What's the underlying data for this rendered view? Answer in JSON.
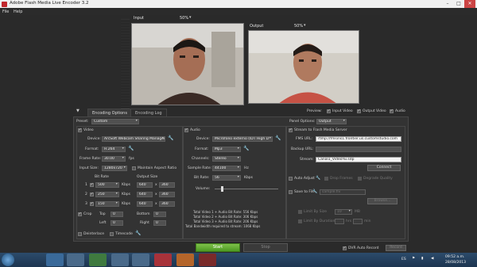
{
  "window": {
    "title": "Adobe Flash Media Live Encoder 3.2"
  },
  "menu": {
    "file": "File",
    "help": "Help"
  },
  "preview": {
    "input_label": "Input",
    "input_zoom": "50%",
    "output_label": "Output",
    "output_zoom": "50%",
    "preview_label": "Preview:",
    "input_video": "Input Video",
    "output_video": "Output Video",
    "audio": "Audio"
  },
  "tabs": {
    "encoding_options": "Encoding Options",
    "encoding_log": "Encoding Log"
  },
  "presets": {
    "label": "Preset:",
    "value": "Custom"
  },
  "panel_options": {
    "label": "Panel Options:",
    "value": "Output"
  },
  "video": {
    "section": "Video",
    "device_label": "Device:",
    "device_value": "ArcSoft Webcam Sharing Manager",
    "format_label": "Format:",
    "format_value": "H.264",
    "frame_rate_label": "Frame Rate:",
    "frame_rate_value": "30.00",
    "fps": "fps",
    "input_size_label": "Input Size:",
    "input_size_value": "1280x720",
    "maintain_aspect": "Maintain Aspect Ratio",
    "bit_rate_header": "Bit Rate",
    "output_size_header": "Output Size",
    "rows": [
      {
        "num": "1",
        "bitrate": "500",
        "unit": "Kbps",
        "w": "640",
        "h": "360"
      },
      {
        "num": "2",
        "bitrate": "250",
        "unit": "Kbps",
        "w": "640",
        "h": "360"
      },
      {
        "num": "3",
        "bitrate": "150",
        "unit": "Kbps",
        "w": "640",
        "h": "360"
      }
    ],
    "crop_label": "Crop",
    "top_label": "Top",
    "top_value": "0",
    "bottom_label": "Bottom",
    "bottom_value": "0",
    "left_label": "Left",
    "left_value": "0",
    "right_label": "Right",
    "right_value": "0",
    "deinterlace": "Deinterlace",
    "timecode": "Timecode"
  },
  "audio": {
    "section": "Audio",
    "device_label": "Device:",
    "device_value": "Micrófono externo (IDT High D",
    "format_label": "Format:",
    "format_value": "Mp3",
    "channels_label": "Channels:",
    "channels_value": "Stereo",
    "sample_rate_label": "Sample Rate:",
    "sample_rate_value": "44100",
    "hz": "Hz",
    "bit_rate_label": "Bit Rate:",
    "bit_rate_value": "56",
    "kbps": "Kbps",
    "volume_label": "Volume:",
    "volume_level": 0.1
  },
  "totals": [
    "Total Video 1 + Audio Bit Rate: 556 Kbps",
    "Total Video 2 + Audio Bit Rate: 306 Kbps",
    "Total Video 3 + Audio Bit Rate: 206 Kbps",
    "Total Bandwidth required to stream: 1068 Kbps"
  ],
  "stream": {
    "stream_to_server": "Stream to Flash Media Server",
    "fms_url_label": "FMS URL:",
    "fms_url_value": "rtmp://fmsins1.frontier.us.customstudio.com",
    "backup_url_label": "Backup URL:",
    "backup_url_value": "",
    "stream_label": "Stream:",
    "stream_value": "Canal1_Video%i.sdp",
    "connect": "Connect",
    "auto_adjust": "Auto Adjust",
    "drop_frames": "Drop Frames",
    "degrade_quality": "Degrade Quality",
    "save_to_file": "Save to File",
    "save_path": "sample.flv",
    "browse": "Browse...",
    "limit_by_size": "Limit By Size",
    "size_value": "10",
    "mb": "MB",
    "limit_by_duration": "Limit By Duration",
    "hrs": "hrs",
    "min": "min"
  },
  "bottom": {
    "start": "Start",
    "stop": "Stop",
    "dvr_auto_record": "DVR Auto Record",
    "record": "Record"
  },
  "taskbar": {
    "lang": "ES",
    "time": "09:52 a.m.",
    "date": "28/08/2013"
  }
}
